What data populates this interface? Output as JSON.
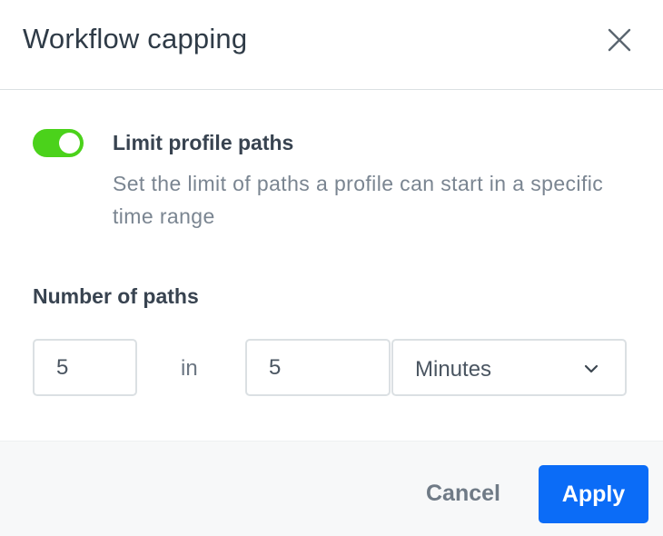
{
  "dialog": {
    "title": "Workflow capping",
    "close_icon": "close-icon"
  },
  "limit_toggle": {
    "enabled": true,
    "color_on": "#4bd21b",
    "title": "Limit profile paths",
    "description": "Set the limit of paths a profile can start in a specific time range"
  },
  "paths": {
    "label": "Number of paths",
    "count_value": "5",
    "in_label": "in",
    "range_value": "5",
    "unit_selected": "Minutes",
    "unit_icon": "chevron-down-icon"
  },
  "footer": {
    "cancel_label": "Cancel",
    "apply_label": "Apply",
    "apply_color": "#0b6cf7"
  }
}
